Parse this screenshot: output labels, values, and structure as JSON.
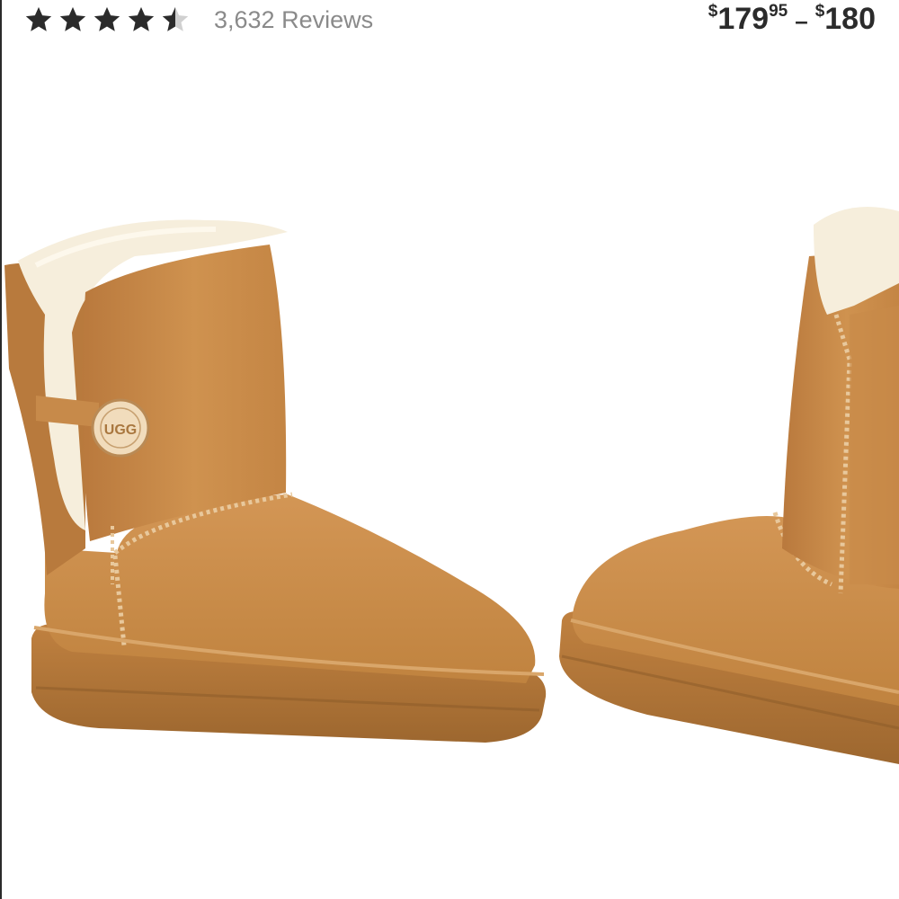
{
  "rating": {
    "value": 4.5,
    "out_of": 5,
    "reviews_text": "3,632 Reviews",
    "star_color": "#2b2b2b",
    "empty_star_color": "#d0d0d0"
  },
  "price": {
    "currency": "$",
    "low_dollars": "179",
    "low_cents": "95",
    "separator": "–",
    "high_dollars": "180"
  },
  "product_image": {
    "button_logo": "UGG",
    "boot_color": "#c98a4b",
    "fur_color": "#f6eedc",
    "sole_color": "#b77a3d"
  }
}
